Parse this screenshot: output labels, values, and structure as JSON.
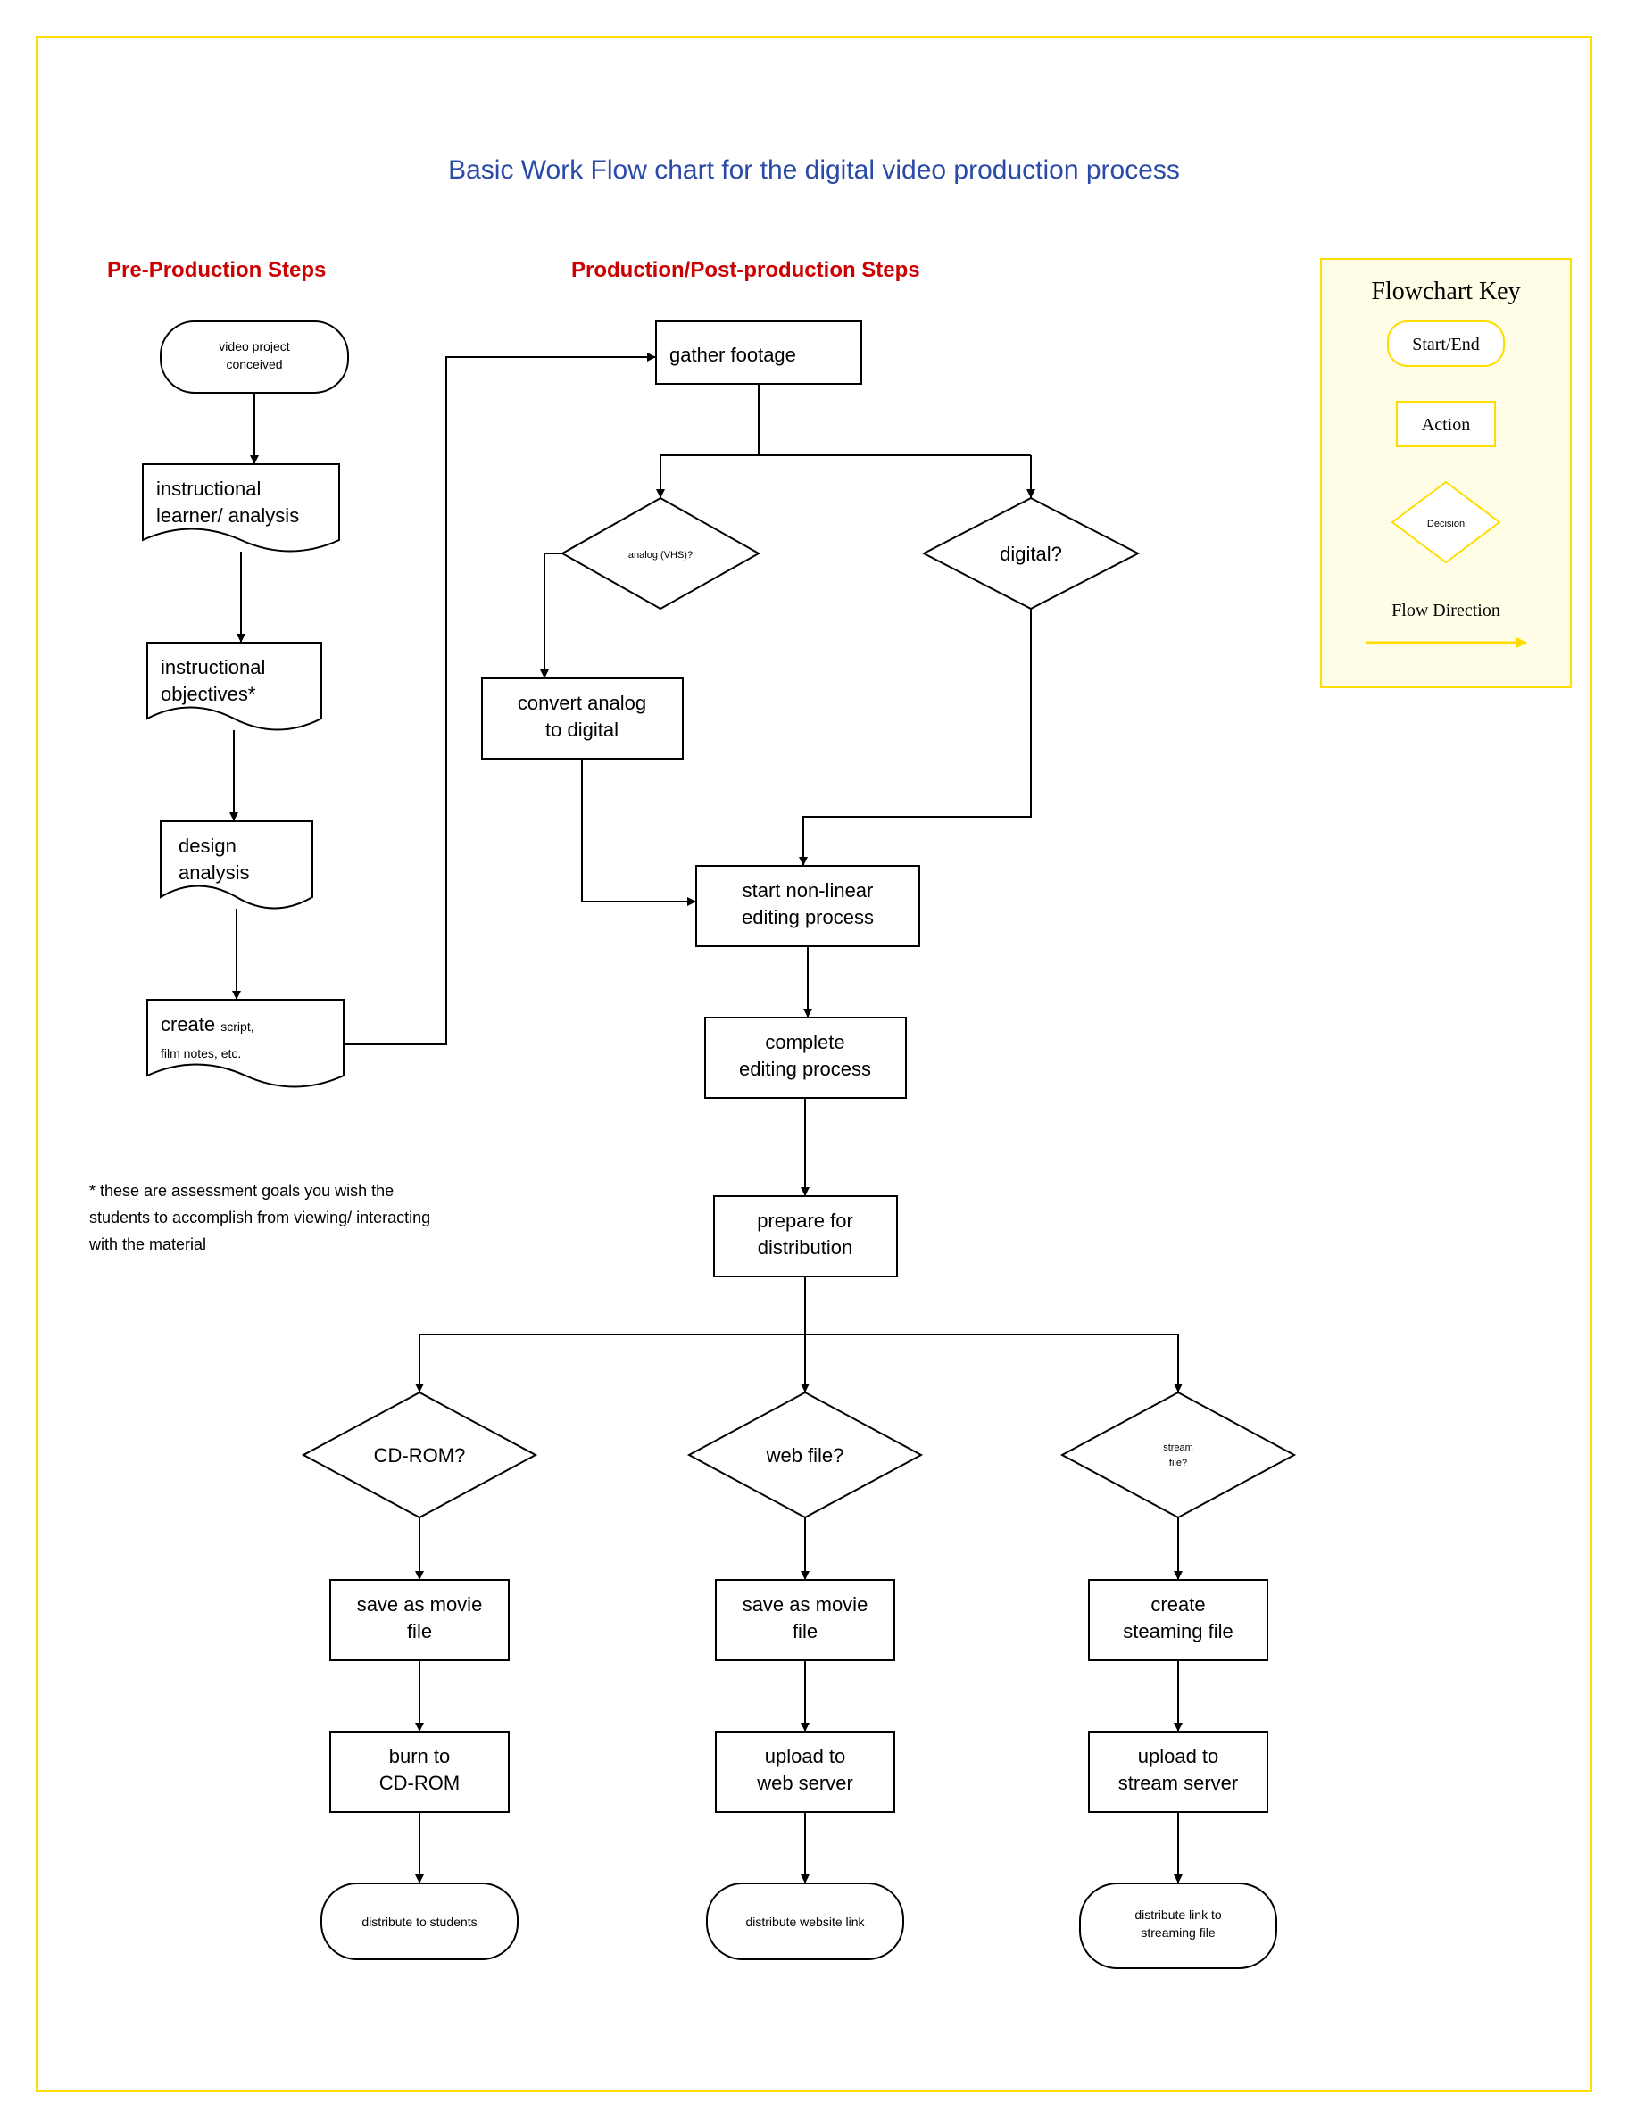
{
  "title": "Basic Work Flow chart for the digital video production process",
  "sections": {
    "pre": "Pre-Production Steps",
    "prod": "Production/Post-production Steps"
  },
  "key": {
    "title": "Flowchart Key",
    "start": "Start/End",
    "action": "Action",
    "decision": "Decision",
    "flow": "Flow Direction"
  },
  "nodes": {
    "conceived": "video project\nconceived",
    "learner": "instructional\nlearner/ analysis",
    "objectives": "instructional\nobjectives*",
    "design": "design\nanalysis",
    "script": "create script,\nfilm notes, etc.",
    "gather": "gather footage",
    "analog": "analog (VHS)?",
    "digital": "digital?",
    "convert": "convert analog\nto digital",
    "startedit": "start non-linear\nediting process",
    "complete": "complete\nediting process",
    "prepare": "prepare for\ndistribution",
    "cdrom": "CD-ROM?",
    "webfile": "web file?",
    "streamq": "stream\nfile?",
    "save1": "save as movie\nfile",
    "save2": "save as movie\nfile",
    "createstream": "create\nsteaming file",
    "burn": "burn to\nCD-ROM",
    "upload1": "upload to\nweb server",
    "upload2": "upload to\nstream server",
    "dist1": "distribute to students",
    "dist2": "distribute website link",
    "dist3": "distribute link to\nstreaming file"
  },
  "footnote": "* these are assessment goals you wish the\nstudents to accomplish from viewing/ interacting\nwith the material"
}
